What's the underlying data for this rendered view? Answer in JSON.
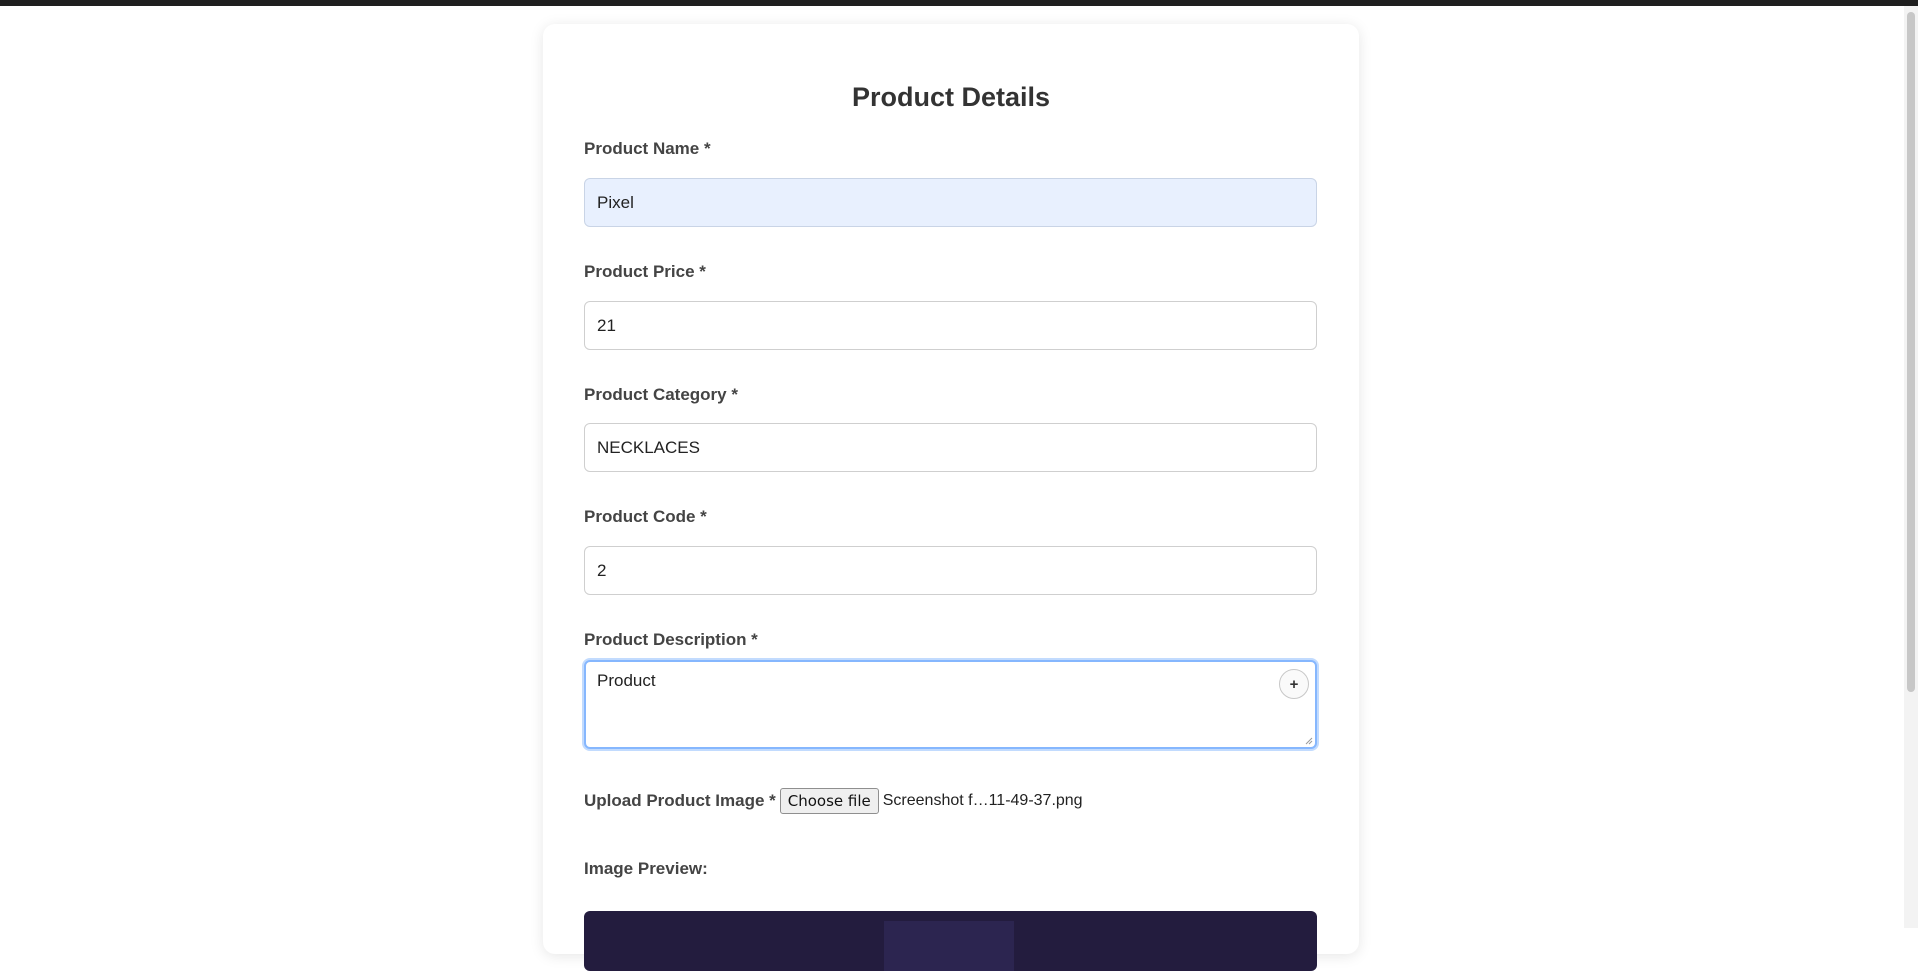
{
  "form": {
    "title": "Product Details",
    "name_label": "Product Name *",
    "name_value": "Pixel",
    "price_label": "Product Price *",
    "price_value": "21",
    "category_label": "Product Category *",
    "category_value": "NECKLACES",
    "code_label": "Product Code *",
    "code_value": "2",
    "description_label": "Product Description *",
    "description_value": "Product",
    "description_add_button": "+",
    "upload_label": "Upload Product Image *",
    "choose_file_button": "Choose file",
    "file_name": "Screenshot f…11-49-37.png",
    "preview_label": "Image Preview:"
  },
  "colors": {
    "autofill_bg": "#e8f0fe",
    "focus_border": "#86b7fe",
    "preview_bg": "#231c3e",
    "topbar": "#1f1f1f"
  }
}
